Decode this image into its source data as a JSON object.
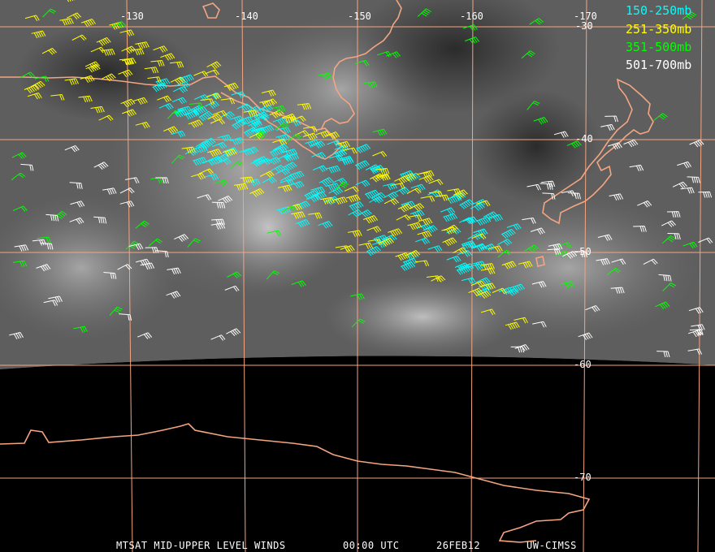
{
  "map": {
    "longitude_labels": [
      "-130",
      "-140",
      "-150",
      "-160",
      "-170"
    ],
    "latitude_labels": [
      "-30",
      "-40",
      "-50",
      "-60",
      "-70"
    ],
    "gridline_color": "#f4a582",
    "coastline_color": "#f4a582"
  },
  "legend": {
    "items": [
      {
        "label": "150-250mb",
        "color": "#00ffff"
      },
      {
        "label": "251-350mb",
        "color": "#ffff00"
      },
      {
        "label": "351-500mb",
        "color": "#00ff00"
      },
      {
        "label": "501-700mb",
        "color": "#ffffff"
      }
    ]
  },
  "footer": {
    "product": "MTSAT MID-UPPER LEVEL WINDS",
    "time": "00:00 UTC",
    "date": "26FEB12",
    "credit": "UW-CIMSS"
  }
}
